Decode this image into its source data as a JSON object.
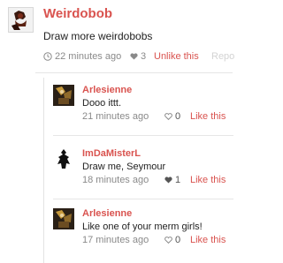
{
  "post": {
    "author": "Weirdobob",
    "text": "Draw more weirdobobs",
    "time": "22 minutes ago",
    "like_count": "3",
    "like_action": "Unlike this",
    "reply_action": "Repo",
    "accent_color": "#d9534f"
  },
  "comments": [
    {
      "author": "Arlesienne",
      "text": "Dooo ittt.",
      "time": "21 minutes ago",
      "like_count": "0",
      "like_action": "Like this",
      "avatar": "arlesienne-avatar"
    },
    {
      "author": "ImDaMisterL",
      "text": "Draw me, Seymour",
      "time": "18 minutes ago",
      "like_count": "1",
      "like_action": "Like this",
      "avatar": "misterl-avatar"
    },
    {
      "author": "Arlesienne",
      "text": "Like one of your merm girls!",
      "time": "17 minutes ago",
      "like_count": "0",
      "like_action": "Like this",
      "avatar": "arlesienne-avatar"
    }
  ]
}
